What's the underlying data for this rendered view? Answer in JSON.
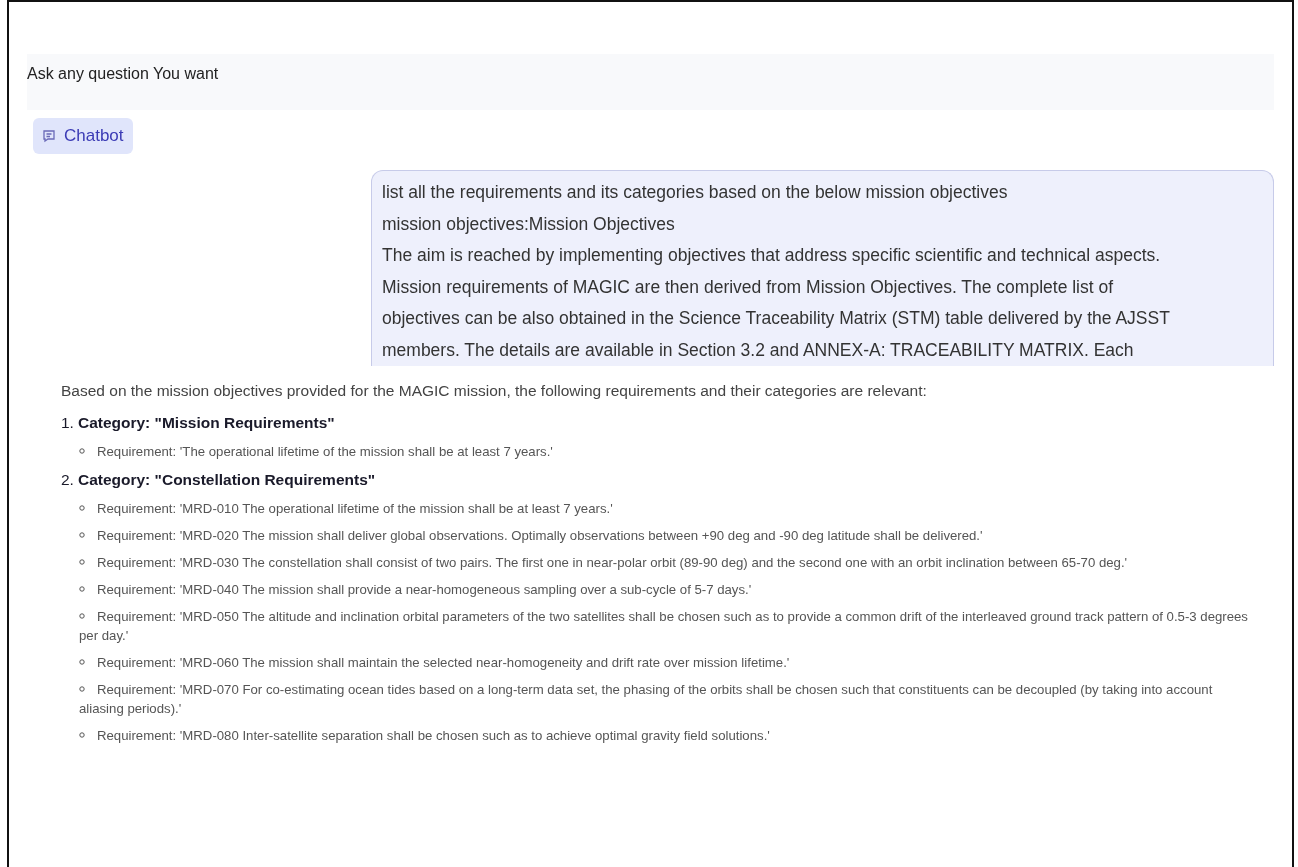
{
  "header": {
    "placeholder": "Ask any question You want"
  },
  "chatbot_label": {
    "text": "Chatbot"
  },
  "user_message": {
    "lines": [
      "list all the requirements and its categories based on the below mission objectives",
      "mission objectives:Mission Objectives",
      "The aim is reached by implementing objectives that address specific scientific and technical aspects.",
      "Mission requirements of MAGIC are then derived from Mission Objectives. The complete list of",
      "objectives can be also obtained in the Science Traceability Matrix (STM) table delivered by the AJSST",
      "members. The details are available in Section 3.2 and ANNEX-A: TRACEABILITY MATRIX. Each"
    ]
  },
  "bot_answer": {
    "intro": "Based on the mission objectives provided for the MAGIC mission, the following requirements and their categories are relevant:",
    "categories": [
      {
        "number": "1.",
        "title": "Category: \"Mission Requirements\"",
        "requirements": [
          "Requirement: 'The operational lifetime of the mission shall be at least 7 years.'"
        ]
      },
      {
        "number": "2.",
        "title": "Category: \"Constellation Requirements\"",
        "requirements": [
          "Requirement: 'MRD-010 The operational lifetime of the mission shall be at least 7 years.'",
          "Requirement: 'MRD-020 The mission shall deliver global observations. Optimally observations between +90 deg and -90 deg latitude shall be delivered.'",
          "Requirement: 'MRD-030 The constellation shall consist of two pairs. The first one in near-polar orbit (89-90 deg) and the second one with an orbit inclination between 65-70 deg.'",
          "Requirement: 'MRD-040 The mission shall provide a near-homogeneous sampling over a sub-cycle of 5-7 days.'",
          "Requirement: 'MRD-050 The altitude and inclination orbital parameters of the two satellites shall be chosen such as to provide a common drift of the interleaved ground track pattern of 0.5-3 degrees per day.'",
          "Requirement: 'MRD-060 The mission shall maintain the selected near-homogeneity and drift rate over mission lifetime.'",
          "Requirement: 'MRD-070 For co-estimating ocean tides based on a long-term data set, the phasing of the orbits shall be chosen such that constituents can be decoupled (by taking into account aliasing periods).'",
          "Requirement: 'MRD-080 Inter-satellite separation shall be chosen such as to achieve optimal gravity field solutions.'"
        ]
      }
    ]
  }
}
